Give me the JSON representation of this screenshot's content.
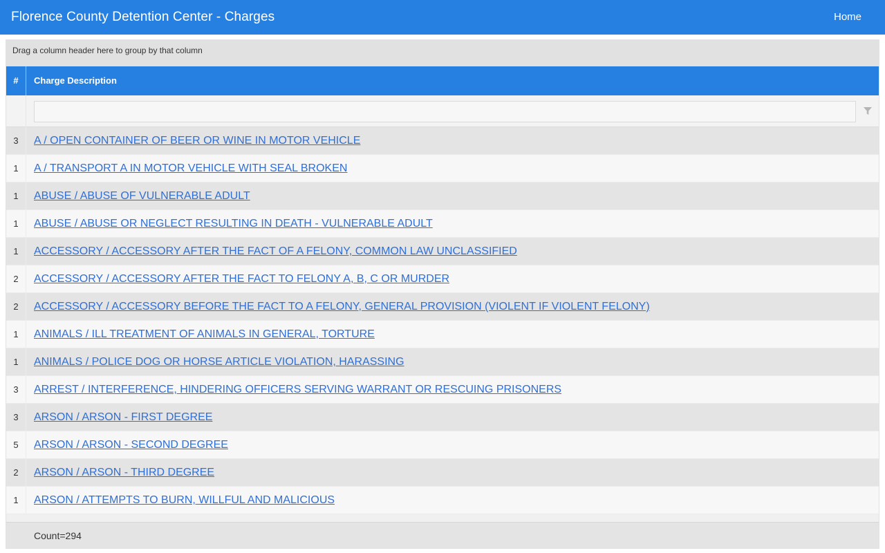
{
  "topbar": {
    "title": "Florence County Detention Center - Charges",
    "home_label": "Home"
  },
  "grid": {
    "group_panel_text": "Drag a column header here to group by that column",
    "columns": {
      "num": "#",
      "desc": "Charge Description"
    },
    "filter": {
      "value": "",
      "placeholder": ""
    },
    "rows": [
      {
        "num": "3",
        "desc": "A / OPEN CONTAINER OF BEER OR WINE IN MOTOR VEHICLE"
      },
      {
        "num": "1",
        "desc": "A / TRANSPORT A IN MOTOR VEHICLE WITH SEAL BROKEN"
      },
      {
        "num": "1",
        "desc": "ABUSE / ABUSE OF VULNERABLE ADULT"
      },
      {
        "num": "1",
        "desc": "ABUSE / ABUSE OR NEGLECT RESULTING IN DEATH - VULNERABLE ADULT"
      },
      {
        "num": "1",
        "desc": "ACCESSORY / ACCESSORY AFTER THE FACT OF A FELONY, COMMON LAW UNCLASSIFIED"
      },
      {
        "num": "2",
        "desc": "ACCESSORY / ACCESSORY AFTER THE FACT TO FELONY A, B, C OR MURDER"
      },
      {
        "num": "2",
        "desc": "ACCESSORY / ACCESSORY BEFORE THE FACT TO A FELONY, GENERAL PROVISION (VIOLENT IF VIOLENT FELONY)"
      },
      {
        "num": "1",
        "desc": "ANIMALS / ILL TREATMENT OF ANIMALS IN GENERAL, TORTURE"
      },
      {
        "num": "1",
        "desc": "ANIMALS / POLICE DOG OR HORSE ARTICLE VIOLATION, HARASSING"
      },
      {
        "num": "3",
        "desc": "ARREST / INTERFERENCE, HINDERING OFFICERS SERVING WARRANT OR RESCUING PRISONERS"
      },
      {
        "num": "3",
        "desc": "ARSON / ARSON - FIRST DEGREE"
      },
      {
        "num": "5",
        "desc": "ARSON / ARSON - SECOND DEGREE"
      },
      {
        "num": "2",
        "desc": "ARSON / ARSON - THIRD DEGREE"
      },
      {
        "num": "1",
        "desc": "ARSON / ATTEMPTS TO BURN, WILLFUL AND MALICIOUS"
      }
    ],
    "footer_count": "Count=294"
  },
  "icons": {
    "filter": "funnel-icon"
  },
  "colors": {
    "accent": "#2680e2",
    "link": "#2f6fd6"
  }
}
